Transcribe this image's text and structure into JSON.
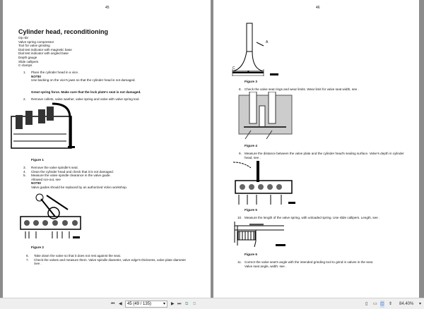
{
  "left_page": {
    "page_number": "45",
    "title": "Cylinder head, reconditioning",
    "tools": [
      "Op nbr",
      "Valve spring compressor",
      "Tool for valve grinding",
      "Dial test indicator with magnetic base",
      "Dial test indicator with angled base",
      "Depth gauge",
      "Slide callipers",
      "C-clamps"
    ],
    "step1": {
      "num": "1.",
      "text": "Place the cylinder head in a vice.",
      "note_label": "NOTE!",
      "note": "Use backing on the vice's jaws so that the cylinder head is not damaged."
    },
    "warning": "Great spring force. Make sure that the lock plate's seat is not damaged.",
    "step2": {
      "num": "2.",
      "text": "Remove collets, valve washer, valve spring and valve with valve spring tool."
    },
    "figure1": "Figure 1",
    "step3": {
      "num": "3.",
      "text": "Remove the valve spindle's seal."
    },
    "step4": {
      "num": "4.",
      "text": "Clean the cylinder head and check that it is not damaged."
    },
    "step5": {
      "num": "5.",
      "text": "Measure the valve spindle clearance in the valve guide.",
      "extra": "Allowed run-out, see",
      "note_label": "NOTE!",
      "note": "Valve guides should be replaced by an authorized Volvo workshop."
    },
    "figure2": "Figure 2",
    "step6": {
      "num": "6.",
      "text": "Take down the valve so that it does not rest against the seat."
    },
    "step7": {
      "num": "7.",
      "text": "Check the valves and measure them. Valve spindle diameter, valve edge's thickness, valve plate diameter",
      "extra": "See ."
    }
  },
  "right_page": {
    "page_number": "46",
    "fig3_labels": {
      "a": "A",
      "b": "B",
      "c": "C"
    },
    "figure3": "Figure 3",
    "step8": {
      "num": "8.",
      "text": "Check the valve seat rings and wear limits. Wear limit for valve seat width, see ."
    },
    "figure4": "Figure 4",
    "step9": {
      "num": "9.",
      "text": "Measure the distance between the valve plate and the cylinder head's sealing surface. Valve's depth in cylinder head, see ."
    },
    "figure5": "Figure 5",
    "step10": {
      "num": "10.",
      "text": "Measure the length of the valve spring, with unloaded spring. Use slide callipers. Length, see ."
    },
    "figure6": "Figure 6",
    "step11": {
      "num": "11.",
      "text": "Correct the valve seat's angle with the intended grinding tool to grind in valves in the seat.",
      "extra": "Valve seat angle, width: see ."
    }
  },
  "toolbar": {
    "page_field": "45 (49 / 135)",
    "zoom": "84.40%"
  }
}
